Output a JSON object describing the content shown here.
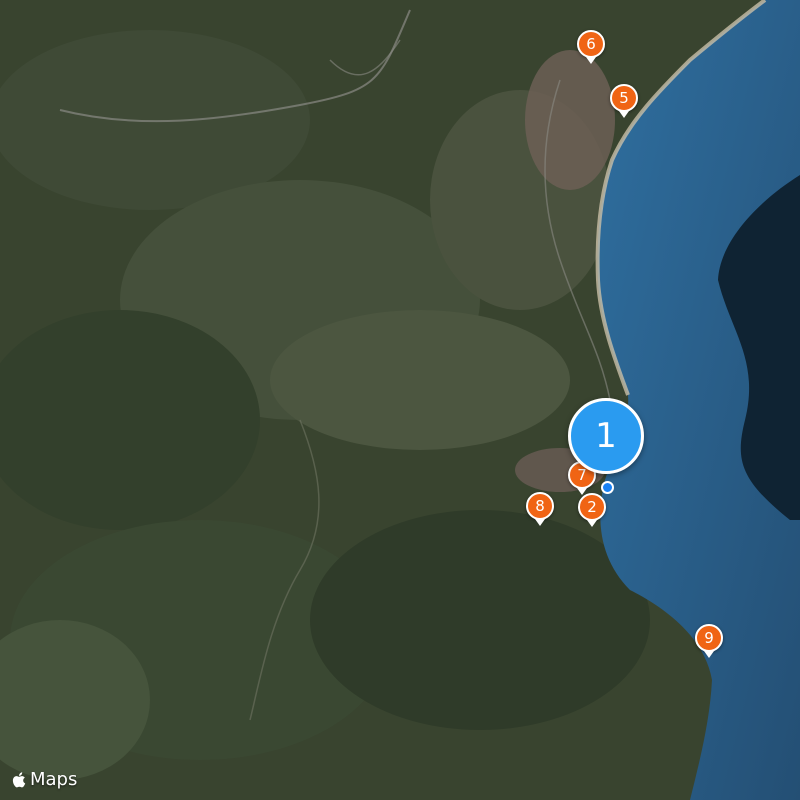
{
  "map": {
    "attribution": {
      "icon": "apple-icon",
      "label": "Maps"
    },
    "cluster": {
      "label": "1",
      "color": "#2a9bf0"
    },
    "markers": [
      {
        "label": "2"
      },
      {
        "label": "5"
      },
      {
        "label": "6"
      },
      {
        "label": "7"
      },
      {
        "label": "8"
      },
      {
        "label": "9"
      }
    ],
    "colors": {
      "marker": "#f06414",
      "sea": "#2e5f86",
      "land": "#3a4634"
    }
  }
}
